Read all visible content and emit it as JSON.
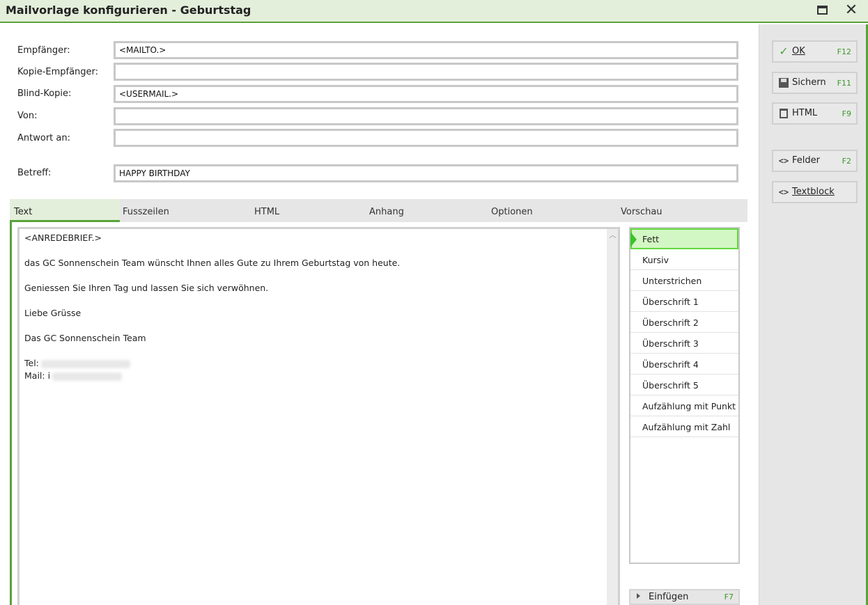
{
  "window": {
    "title": "Mailvorlage konfigurieren - Geburtstag"
  },
  "fields": [
    {
      "label": "Empfänger:",
      "value": "<MAILTO.>"
    },
    {
      "label": "Kopie-Empfänger:",
      "value": ""
    },
    {
      "label": "Blind-Kopie:",
      "value": "<USERMAIL.>"
    },
    {
      "label": "Von:",
      "value": ""
    },
    {
      "label": "Antwort an:",
      "value": ""
    },
    {
      "label": "Betreff:",
      "value": "HAPPY BIRTHDAY"
    }
  ],
  "tabs": [
    "Text",
    "Fusszeilen",
    "HTML",
    "Anhang",
    "Optionen",
    "Vorschau"
  ],
  "editor": {
    "lines": [
      "<ANREDEBRIEF.>",
      "das GC Sonnenschein Team wünscht Ihnen alles Gute zu Ihrem Geburtstag von heute.",
      "Geniessen Sie Ihren Tag und lassen Sie sich verwöhnen.",
      "Liebe Grüsse",
      "Das GC Sonnenschein Team",
      "Tel:",
      "Mail: i"
    ]
  },
  "format_list": {
    "items": [
      "Fett",
      "Kursiv",
      "Unterstrichen",
      "Überschrift 1",
      "Überschrift 2",
      "Überschrift 3",
      "Überschrift 4",
      "Überschrift 5",
      "Aufzählung mit Punkt",
      "Aufzählung mit Zahl"
    ],
    "selected": "Fett"
  },
  "insert": {
    "label": "Einfügen",
    "shortcut": "F7"
  },
  "actions": [
    {
      "label": "OK",
      "shortcut": "F12",
      "icon": "check-icon"
    },
    {
      "label": "Sichern",
      "shortcut": "F11",
      "icon": "save-icon"
    },
    {
      "label": "HTML",
      "shortcut": "F9",
      "icon": "clipboard-icon"
    },
    {
      "label": "Felder",
      "shortcut": "F2",
      "icon": "code-icon"
    },
    {
      "label": "Textblock",
      "shortcut": "",
      "icon": "code-icon"
    }
  ],
  "colors": {
    "accent": "#5aa23a",
    "selected_bg": "#d3f7c4",
    "shortcut": "#3a9a2a"
  }
}
